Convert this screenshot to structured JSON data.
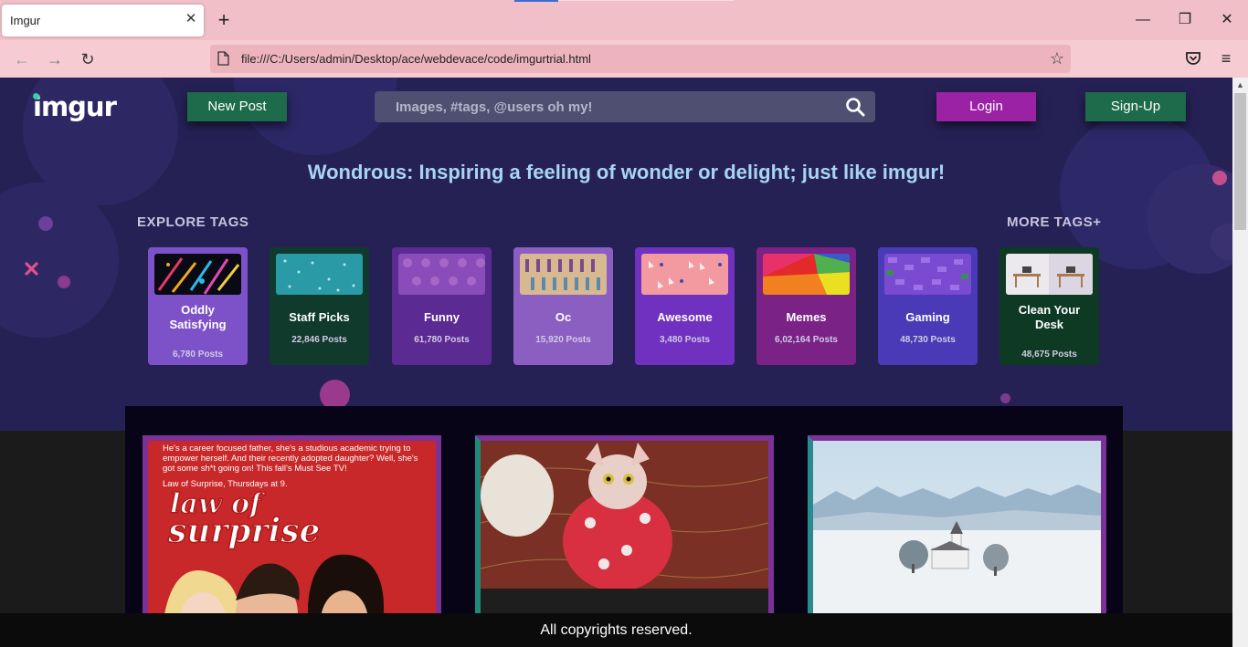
{
  "browser": {
    "tab_title": "Imgur",
    "tab_close": "✕",
    "new_tab": "+",
    "window_minimize": "—",
    "window_restore": "❐",
    "window_close": "✕",
    "back": "←",
    "forward": "→",
    "reload": "↻",
    "url": "file:///C:/Users/admin/Desktop/ace/webdevace/code/imgurtrial.html",
    "bookmark_star": "☆",
    "menu": "≡"
  },
  "header": {
    "logo": "imgur",
    "new_post": "New Post",
    "search_placeholder": "Images, #tags, @users oh my!",
    "login": "Login",
    "signup": "Sign-Up"
  },
  "tagline": "Wondrous: Inspiring a feeling of wonder or delight; just like imgur!",
  "explore_label": "EXPLORE TAGS",
  "more_tags_label": "MORE TAGS+",
  "tags": [
    {
      "name": "Oddly Satisfying",
      "posts": "6,780 Posts",
      "color": "#7d52c8"
    },
    {
      "name": "Staff Picks",
      "posts": "22,846 Posts",
      "color": "#0f3a2c"
    },
    {
      "name": "Funny",
      "posts": "61,780 Posts",
      "color": "#5c2a93"
    },
    {
      "name": "Oc",
      "posts": "15,920 Posts",
      "color": "#8b5fc2"
    },
    {
      "name": "Awesome",
      "posts": "3,480 Posts",
      "color": "#7030c0"
    },
    {
      "name": "Memes",
      "posts": "6,02,164 Posts",
      "color": "#7a2286"
    },
    {
      "name": "Gaming",
      "posts": "48,730 Posts",
      "color": "#4a3ab8"
    },
    {
      "name": "Clean Your Desk",
      "posts": "48,675 Posts",
      "color": "#0e3a24"
    }
  ],
  "posts": [
    {
      "caption": "He's a career focused father, she's a studious academic trying to empower herself. And their recently adopted daughter? Well, she's got some sh*t going on! This fall's Must See TV!",
      "caption2": "Law of Surprise, Thursdays at 9.",
      "title_line1": "law of",
      "title_line2": "surprise"
    },
    {},
    {}
  ],
  "footer": "All copyrights reserved."
}
